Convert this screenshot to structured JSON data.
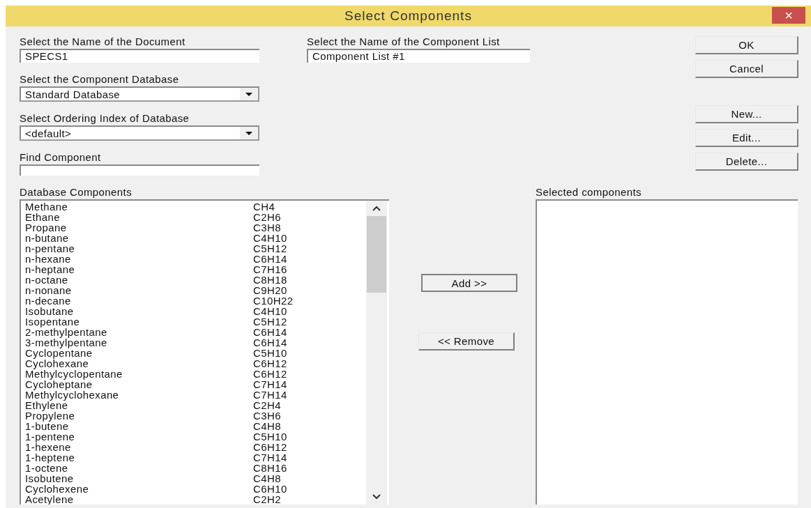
{
  "window": {
    "title": "Select Components",
    "close": "×"
  },
  "document_name": {
    "label": "Select the Name of the Document",
    "value": "SPECS1"
  },
  "component_list_name": {
    "label": "Select the Name of the Component List",
    "value": "Component List #1"
  },
  "database": {
    "label": "Select the Component Database",
    "value": "Standard Database"
  },
  "ordering_index": {
    "label": "Select Ordering Index of Database",
    "value": "<default>"
  },
  "find_component": {
    "label": "Find Component"
  },
  "top_buttons": [
    {
      "label": "OK"
    },
    {
      "label": "Cancel"
    }
  ],
  "list_buttons": [
    {
      "label": "New..."
    },
    {
      "label": "Edit..."
    },
    {
      "label": "Delete..."
    }
  ],
  "database_components": {
    "label": "Database Components",
    "rows": [
      {
        "name": "Methane",
        "formula": "CH4"
      },
      {
        "name": "Ethane",
        "formula": "C2H6"
      },
      {
        "name": "Propane",
        "formula": "C3H8"
      },
      {
        "name": "n-butane",
        "formula": "C4H10"
      },
      {
        "name": "n-pentane",
        "formula": "C5H12"
      },
      {
        "name": "n-hexane",
        "formula": "C6H14"
      },
      {
        "name": "n-heptane",
        "formula": "C7H16"
      },
      {
        "name": "n-octane",
        "formula": "C8H18"
      },
      {
        "name": "n-nonane",
        "formula": "C9H20"
      },
      {
        "name": "n-decane",
        "formula": "C10H22"
      },
      {
        "name": "Isobutane",
        "formula": "C4H10"
      },
      {
        "name": "Isopentane",
        "formula": "C5H12"
      },
      {
        "name": "2-methylpentane",
        "formula": "C6H14"
      },
      {
        "name": "3-methylpentane",
        "formula": "C6H14"
      },
      {
        "name": "Cyclopentane",
        "formula": "C5H10"
      },
      {
        "name": "Cyclohexane",
        "formula": "C6H12"
      },
      {
        "name": "Methylcyclopentane",
        "formula": "C6H12"
      },
      {
        "name": "Cycloheptane",
        "formula": "C7H14"
      },
      {
        "name": "Methylcyclohexane",
        "formula": "C7H14"
      },
      {
        "name": "Ethylene",
        "formula": "C2H4"
      },
      {
        "name": "Propylene",
        "formula": "C3H6"
      },
      {
        "name": "1-butene",
        "formula": "C4H8"
      },
      {
        "name": "1-pentene",
        "formula": "C5H10"
      },
      {
        "name": "1-hexene",
        "formula": "C6H12"
      },
      {
        "name": "1-heptene",
        "formula": "C7H14"
      },
      {
        "name": "1-octene",
        "formula": "C8H16"
      },
      {
        "name": "Isobutene",
        "formula": "C4H8"
      },
      {
        "name": "Cyclohexene",
        "formula": "C6H10"
      },
      {
        "name": "Acetylene",
        "formula": "C2H2"
      }
    ]
  },
  "transfer_buttons": [
    {
      "label": "Add >>"
    },
    {
      "label": "<< Remove"
    }
  ],
  "selected_components": {
    "label": "Selected components"
  }
}
